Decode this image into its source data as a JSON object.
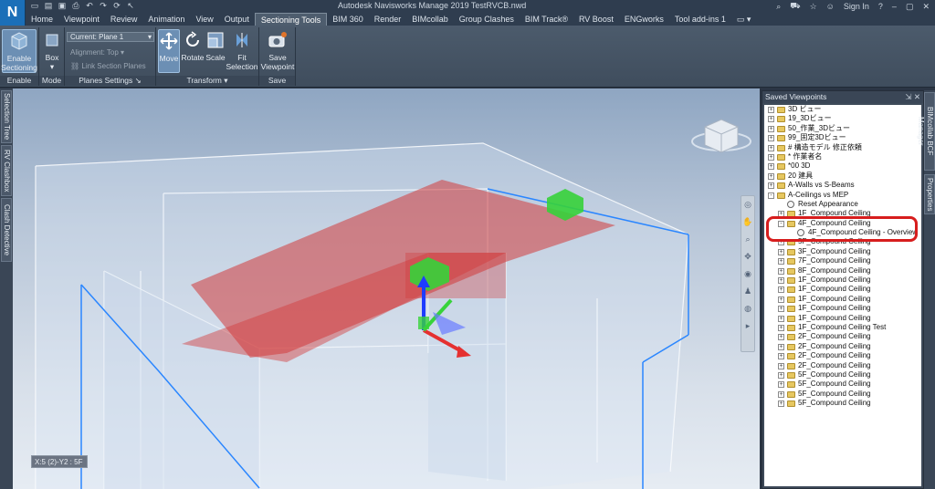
{
  "app": {
    "logo": "N",
    "title": "Autodesk Navisworks Manage 2019    TestRVCB.nwd",
    "sign_in": "Sign In",
    "help": "?"
  },
  "tabs": [
    "Home",
    "Viewpoint",
    "Review",
    "Animation",
    "View",
    "Output",
    "Sectioning Tools",
    "BIM 360",
    "Render",
    "BIMcollab",
    "Group Clashes",
    "BIM Track®",
    "RV Boost",
    "ENGworks",
    "Tool add-ins 1"
  ],
  "active_tab": "Sectioning Tools",
  "ribbon": {
    "enable_sectioning": "Enable Sectioning",
    "box": "Box",
    "current_plane": "Current: Plane 1",
    "alignment": "Alignment: Top",
    "link_section_planes": "Link Section Planes",
    "move": "Move",
    "rotate": "Rotate",
    "scale": "Scale",
    "fit_selection": "Fit Selection",
    "save_viewpoint": "Save Viewpoint",
    "panels": [
      "Enable",
      "Mode",
      "Planes Settings",
      "Transform",
      "Save"
    ]
  },
  "left_tabs": [
    "Selection Tree",
    "RV Clashbox",
    "Clash Detective"
  ],
  "right_tabs": [
    "BIMcollab BCF Manager",
    "Properties"
  ],
  "viewport": {
    "status": "X:5 (2)-Y2 : 5F"
  },
  "saved_viewpoints": {
    "title": "Saved Viewpoints",
    "rows": [
      {
        "label": "3D ビュー",
        "kind": "folder",
        "level": 0,
        "pm": "+"
      },
      {
        "label": "19_3Dビュー",
        "kind": "folder",
        "level": 0,
        "pm": "+"
      },
      {
        "label": "50_作業_3Dビュー",
        "kind": "folder",
        "level": 0,
        "pm": "+"
      },
      {
        "label": "99_固定3Dビュー",
        "kind": "folder",
        "level": 0,
        "pm": "+"
      },
      {
        "label": "# 構造モデル  修正依頼",
        "kind": "folder",
        "level": 0,
        "pm": "+"
      },
      {
        "label": "* 作業者名",
        "kind": "folder",
        "level": 0,
        "pm": "+"
      },
      {
        "label": "*00 3D",
        "kind": "folder",
        "level": 0,
        "pm": "+"
      },
      {
        "label": "20 建具",
        "kind": "folder",
        "level": 0,
        "pm": "+"
      },
      {
        "label": "A-Walls vs S-Beams",
        "kind": "folder",
        "level": 0,
        "pm": "+"
      },
      {
        "label": "A-Ceilings vs MEP",
        "kind": "folder",
        "level": 0,
        "pm": "-"
      },
      {
        "label": "Reset Appearance",
        "kind": "viewpoint",
        "level": 1,
        "pm": ""
      },
      {
        "label": "1F_Compound Ceiling",
        "kind": "folder",
        "level": 1,
        "pm": "+"
      },
      {
        "label": "4F_Compound Ceiling",
        "kind": "folder",
        "level": 1,
        "pm": "-"
      },
      {
        "label": "4F_Compound Ceiling - Overview",
        "kind": "viewpoint",
        "level": 2,
        "pm": ""
      },
      {
        "label": "5F_Compound Ceiling",
        "kind": "folder",
        "level": 1,
        "pm": "+"
      },
      {
        "label": "3F_Compound Ceiling",
        "kind": "folder",
        "level": 1,
        "pm": "+"
      },
      {
        "label": "7F_Compound Ceiling",
        "kind": "folder",
        "level": 1,
        "pm": "+"
      },
      {
        "label": "8F_Compound Ceiling",
        "kind": "folder",
        "level": 1,
        "pm": "+"
      },
      {
        "label": "1F_Compound Ceiling",
        "kind": "folder",
        "level": 1,
        "pm": "+"
      },
      {
        "label": "1F_Compound Ceiling",
        "kind": "folder",
        "level": 1,
        "pm": "+"
      },
      {
        "label": "1F_Compound Ceiling",
        "kind": "folder",
        "level": 1,
        "pm": "+"
      },
      {
        "label": "1F_Compound Ceiling",
        "kind": "folder",
        "level": 1,
        "pm": "+"
      },
      {
        "label": "1F_Compound Ceiling",
        "kind": "folder",
        "level": 1,
        "pm": "+"
      },
      {
        "label": "1F_Compound Ceiling Test",
        "kind": "folder",
        "level": 1,
        "pm": "+"
      },
      {
        "label": "2F_Compound Ceiling",
        "kind": "folder",
        "level": 1,
        "pm": "+"
      },
      {
        "label": "2F_Compound Ceiling",
        "kind": "folder",
        "level": 1,
        "pm": "+"
      },
      {
        "label": "2F_Compound Ceiling",
        "kind": "folder",
        "level": 1,
        "pm": "+"
      },
      {
        "label": "2F_Compound Ceiling",
        "kind": "folder",
        "level": 1,
        "pm": "+"
      },
      {
        "label": "5F_Compound Ceiling",
        "kind": "folder",
        "level": 1,
        "pm": "+"
      },
      {
        "label": "5F_Compound Ceiling",
        "kind": "folder",
        "level": 1,
        "pm": "+"
      },
      {
        "label": "5F_Compound Ceiling",
        "kind": "folder",
        "level": 1,
        "pm": "+"
      },
      {
        "label": "5F_Compound Ceiling",
        "kind": "folder",
        "level": 1,
        "pm": "+"
      }
    ]
  },
  "colors": {
    "highlight": "#d71d1d",
    "red_plane": "#d23a3a",
    "green_box": "#36d23a",
    "gizmo_blue": "#1e3cff"
  }
}
